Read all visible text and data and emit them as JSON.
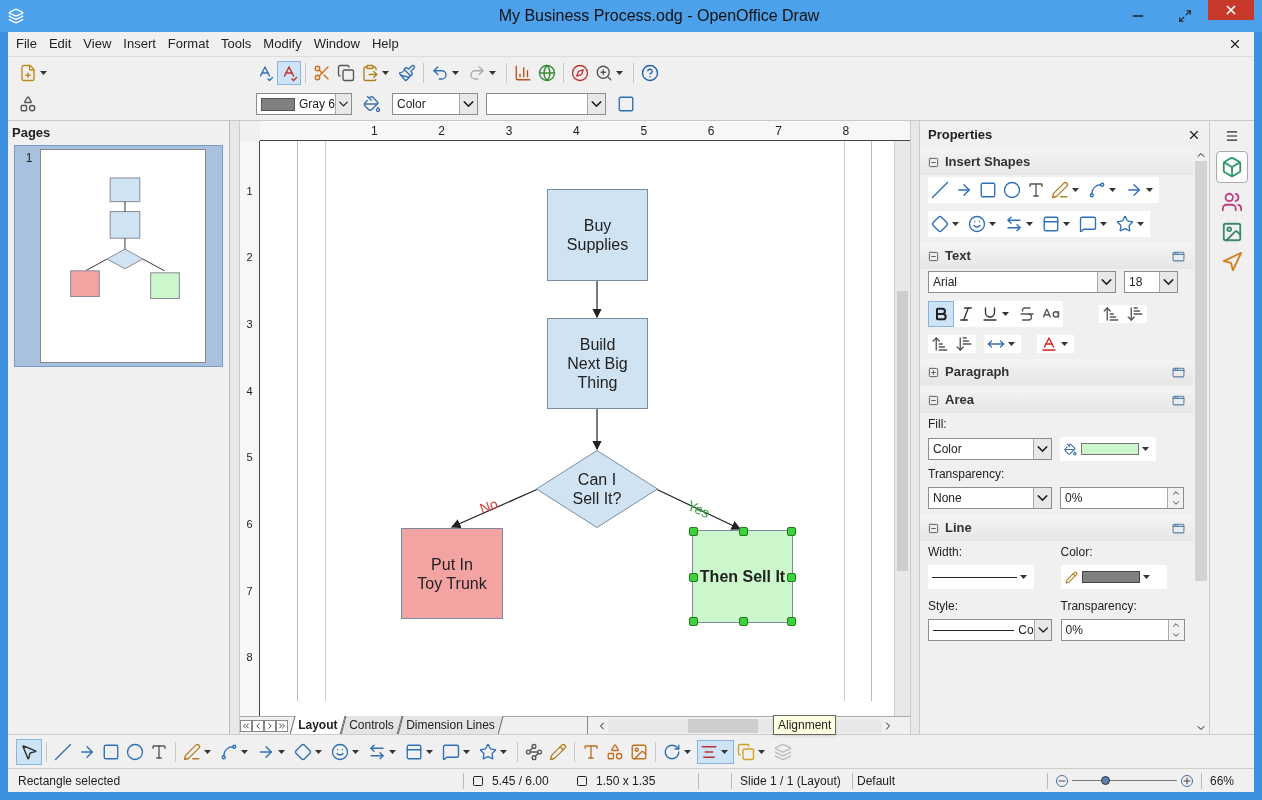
{
  "window": {
    "title": "My Business Process.odg - OpenOffice Draw"
  },
  "menu": [
    "File",
    "Edit",
    "View",
    "Insert",
    "Format",
    "Tools",
    "Modify",
    "Window",
    "Help"
  ],
  "line_toolbar": {
    "line_color": "Gray 6",
    "fill_type": "Color"
  },
  "pages_panel": {
    "title": "Pages",
    "pages": [
      {
        "number": "1",
        "selected": true
      }
    ]
  },
  "ruler": {
    "horizontal": [
      "1",
      "2",
      "3",
      "4",
      "5",
      "6",
      "7",
      "8"
    ],
    "vertical": [
      "1",
      "2",
      "3",
      "4",
      "5",
      "6",
      "7",
      "8"
    ]
  },
  "diagram": {
    "nodes": [
      {
        "kind": "box",
        "text": "Buy\nSupplies",
        "color": "#cfe3f2",
        "selected": false,
        "bold": false
      },
      {
        "kind": "box",
        "text": "Build\nNext Big\nThing",
        "color": "#cfe3f2",
        "selected": false,
        "bold": false
      },
      {
        "kind": "diamond",
        "text": "Can I\nSell It?",
        "color": "#cfe3f2",
        "selected": false,
        "bold": false
      },
      {
        "kind": "box",
        "text": "Put In\nToy Trunk",
        "color": "#f4a3a3",
        "selected": false,
        "bold": false
      },
      {
        "kind": "box",
        "text": "Then Sell It",
        "color": "#ccf7cc",
        "selected": true,
        "bold": true
      }
    ],
    "labels": [
      {
        "text": "No",
        "color": "#d83b3b"
      },
      {
        "text": "Yes",
        "color": "#2e9e3a"
      }
    ]
  },
  "sheet_tabs": [
    {
      "label": "Layout",
      "selected": true
    },
    {
      "label": "Controls",
      "selected": false
    },
    {
      "label": "Dimension Lines",
      "selected": false
    }
  ],
  "tooltip": "Alignment",
  "sidebar": {
    "title": "Properties",
    "insert_shapes": {
      "title": "Insert Shapes",
      "expanded": true
    },
    "text": {
      "title": "Text",
      "expanded": true,
      "font": "Arial",
      "size": "18",
      "bold": true
    },
    "paragraph": {
      "title": "Paragraph",
      "expanded": false
    },
    "area": {
      "title": "Area",
      "expanded": true,
      "fill_label": "Fill:",
      "fill": "Color",
      "transparency_label": "Transparency:",
      "transparency": "None",
      "transparency_value": "0%"
    },
    "line": {
      "title": "Line",
      "expanded": true,
      "width_label": "Width:",
      "color_label": "Color:",
      "style_label": "Style:",
      "style": "Co",
      "transparency_label": "Transparency:",
      "transparency_value": "0%"
    }
  },
  "status_bar": {
    "message": "Rectangle selected",
    "position": "5.45 / 6.00",
    "size": "1.50 x 1.35",
    "slide": "Slide 1 / 1 (Layout)",
    "master": "Default",
    "zoom": {
      "level": 0.31,
      "reading": "66%"
    }
  }
}
